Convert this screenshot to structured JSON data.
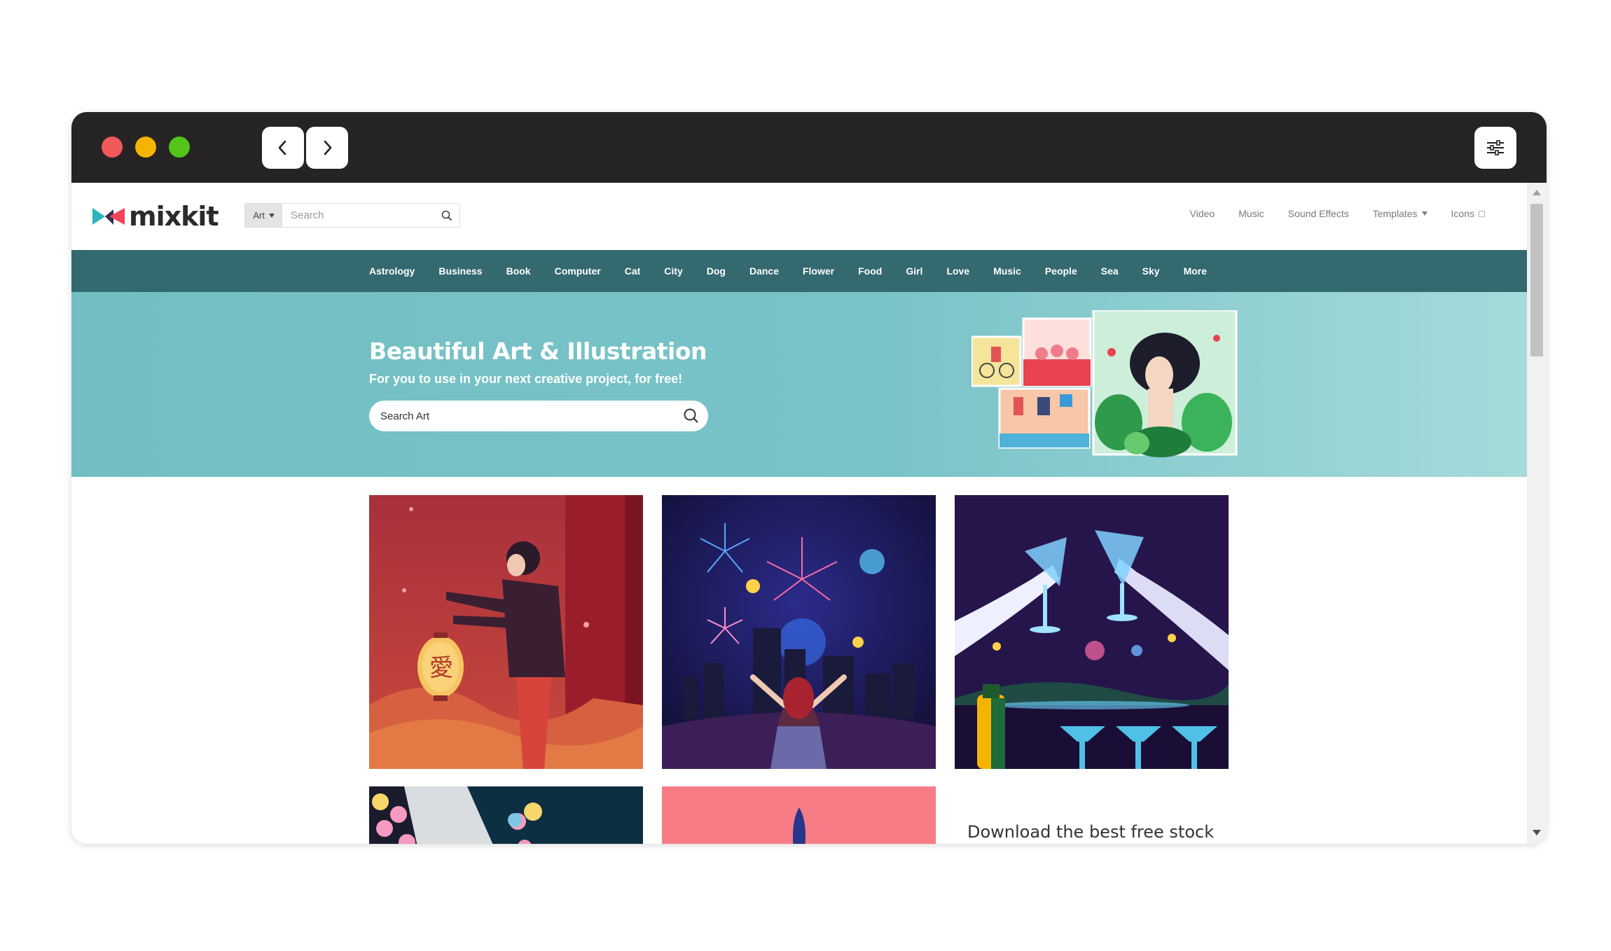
{
  "window": {
    "controls": [
      "close",
      "minimize",
      "maximize"
    ],
    "nav": {
      "back_icon": "chevron-left-icon",
      "forward_icon": "chevron-right-icon",
      "menu_icon": "sliders-icon"
    }
  },
  "header": {
    "logo_text": "mixkit",
    "search": {
      "category": "Art",
      "placeholder": "Search"
    },
    "nav": [
      {
        "label": "Video"
      },
      {
        "label": "Music"
      },
      {
        "label": "Sound Effects"
      },
      {
        "label": "Templates"
      },
      {
        "label": "Icons"
      }
    ]
  },
  "categories": [
    "Astrology",
    "Business",
    "Book",
    "Computer",
    "Cat",
    "City",
    "Dog",
    "Dance",
    "Flower",
    "Food",
    "Girl",
    "Love",
    "Music",
    "People",
    "Sea",
    "Sky",
    "More"
  ],
  "hero": {
    "title": "Beautiful Art & Illustration",
    "subtitle": "For you to use in your next creative project, for free!",
    "search_placeholder": "Search Art"
  },
  "grid": {
    "cards": [
      {
        "name": "lantern-girl"
      },
      {
        "name": "city-fireworks"
      },
      {
        "name": "champagne-toast"
      },
      {
        "name": "balloons"
      },
      {
        "name": "pink-feather"
      }
    ],
    "promo_text": "Download the best free stock"
  },
  "colors": {
    "titlebar": "#262324",
    "category_bar": "#33696f",
    "hero_bg": "#72bfc3"
  }
}
